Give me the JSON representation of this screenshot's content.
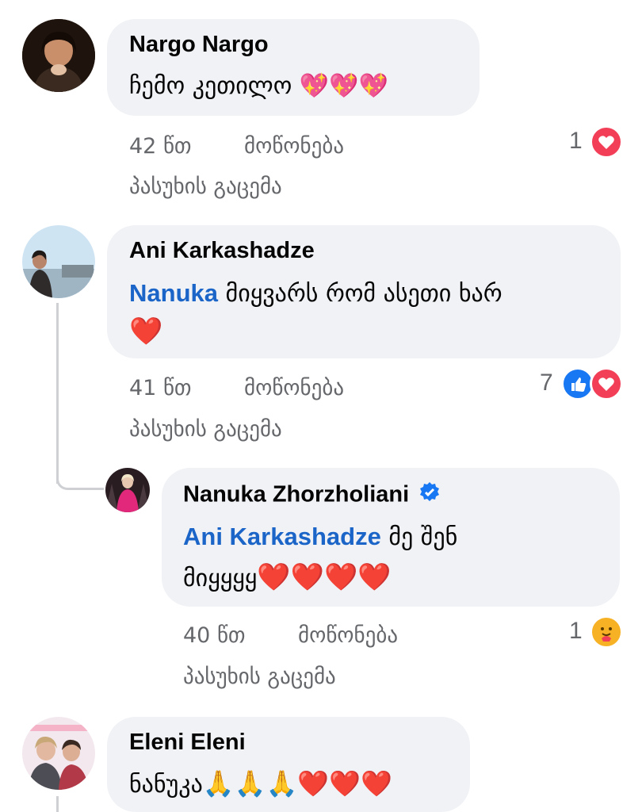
{
  "comments": [
    {
      "author": "Nargo Nargo",
      "text": "ჩემო კეთილო ",
      "emojis": "💖💖💖",
      "time": "42 წთ",
      "like_label": "მოწონება",
      "reply_label": "პასუხის გაცემა",
      "reaction_count": "1",
      "reactions": [
        "love"
      ]
    },
    {
      "author": "Ani Karkashadze",
      "mention": "Nanuka",
      "text": " მიყვარს რომ ასეთი ხარ",
      "emojis": "❤️",
      "time": "41 წთ",
      "like_label": "მოწონება",
      "reply_label": "პასუხის გაცემა",
      "reaction_count": "7",
      "reactions": [
        "like",
        "love"
      ],
      "reply": {
        "author": "Nanuka Zhorzholiani",
        "verified": true,
        "mention": "Ani Karkashadze",
        "text": " მე შენ",
        "text_line2": "მიყყყყ",
        "emojis": "❤️❤️❤️❤️",
        "time": "40 წთ",
        "like_label": "მოწონება",
        "reply_label": "პასუხის გაცემა",
        "reaction_count": "1",
        "reactions": [
          "care"
        ]
      }
    },
    {
      "author": "Eleni Eleni",
      "text": "ნანუკა",
      "emojis": "🙏🙏🙏❤️❤️❤️"
    }
  ],
  "colors": {
    "bubble": "#f0f2f5",
    "mention": "#1b65c8",
    "meta": "#65676b",
    "love": "#f33e58",
    "like": "#1877f2",
    "care": "#f7b125"
  }
}
